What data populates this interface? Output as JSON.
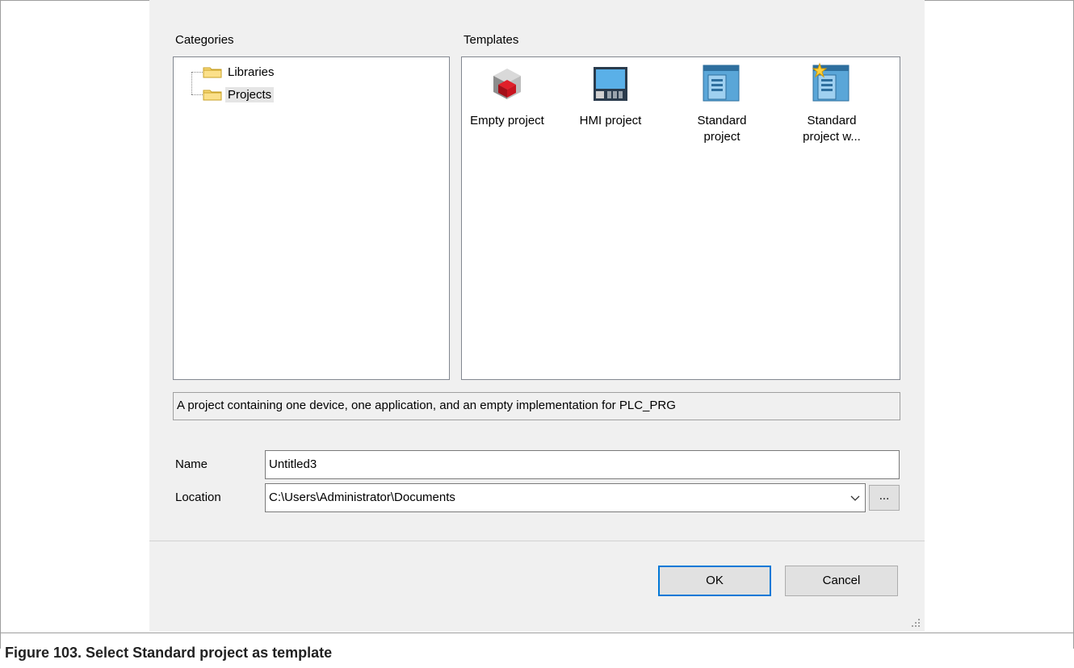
{
  "dialog": {
    "categories_label": "Categories",
    "templates_label": "Templates",
    "categories": [
      {
        "label": "Libraries",
        "icon": "folder-icon"
      },
      {
        "label": "Projects",
        "icon": "folder-icon",
        "selected": true
      }
    ],
    "templates": [
      {
        "label": "Empty project",
        "icon": "empty-project-icon"
      },
      {
        "label": "HMI project",
        "icon": "hmi-project-icon"
      },
      {
        "label": "Standard project",
        "icon": "standard-project-icon",
        "selected": true
      },
      {
        "label": "Standard project w...",
        "icon": "standard-project-wizard-icon"
      }
    ],
    "description": "A project containing one device, one application, and an empty implementation for PLC_PRG",
    "name_label": "Name",
    "name_value": "Untitled3",
    "location_label": "Location",
    "location_value": "C:\\Users\\Administrator\\Documents",
    "browse_label": "...",
    "ok_label": "OK",
    "cancel_label": "Cancel"
  },
  "caption": "Figure 103.  Select Standard project as template",
  "colors": {
    "selection": "#0078d7",
    "dialog_bg": "#f0f0f0"
  }
}
